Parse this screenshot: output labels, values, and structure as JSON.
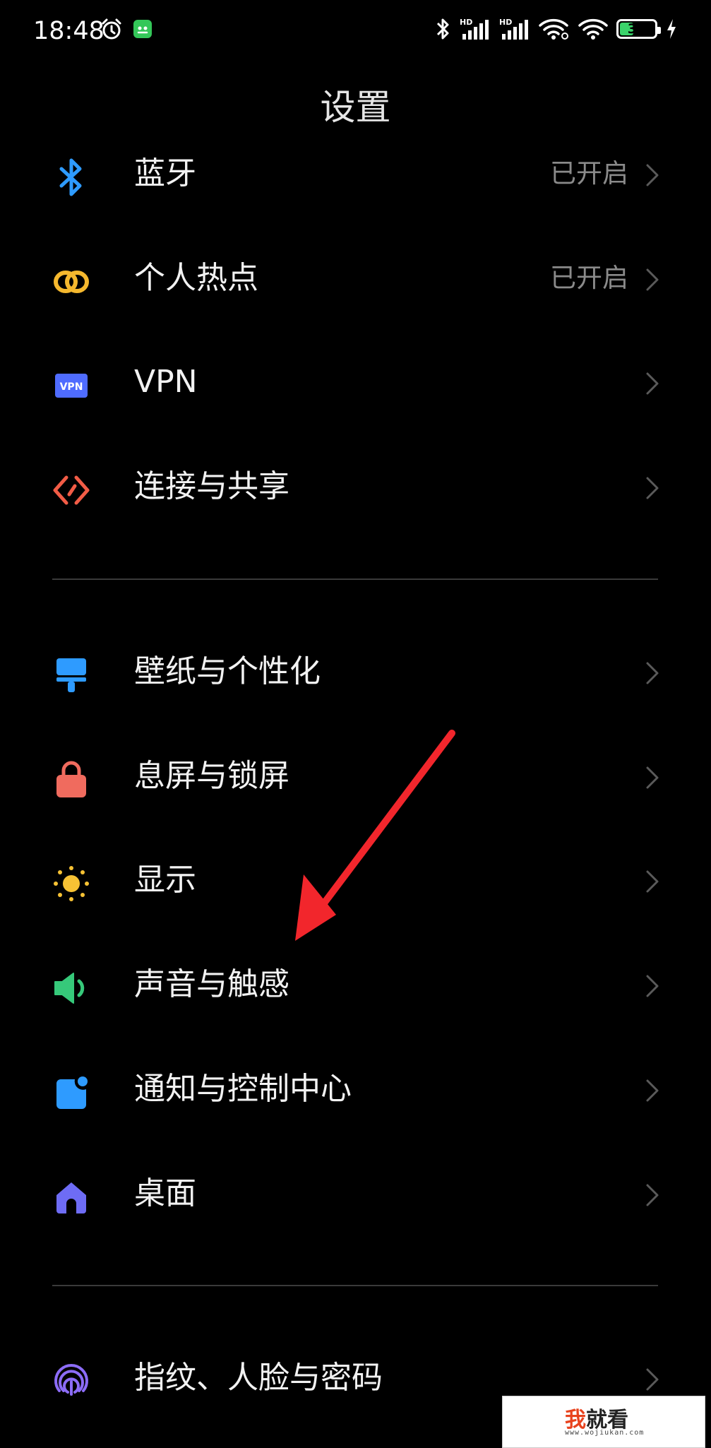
{
  "status_bar": {
    "time": "18:48",
    "battery_level": "36",
    "signal_label": "HD"
  },
  "page_title": "设置",
  "group1": [
    {
      "label": "蓝牙",
      "status": "已开启",
      "icon": "bluetooth-icon",
      "color": "#2e9bff"
    },
    {
      "label": "个人热点",
      "status": "已开启",
      "icon": "hotspot-icon",
      "color": "#f5b82e"
    },
    {
      "label": "VPN",
      "status": "",
      "icon": "vpn-icon",
      "color": "#4f6cff",
      "icon_text": "VPN"
    },
    {
      "label": "连接与共享",
      "status": "",
      "icon": "connection-share-icon",
      "color": "#f25c46"
    }
  ],
  "group2": [
    {
      "label": "壁纸与个性化",
      "icon": "wallpaper-icon",
      "color": "#2e9bff"
    },
    {
      "label": "息屏与锁屏",
      "icon": "lock-icon",
      "color": "#f06b5e"
    },
    {
      "label": "显示",
      "icon": "display-sun-icon",
      "color": "#f7c234"
    },
    {
      "label": "声音与触感",
      "icon": "sound-icon",
      "color": "#36c97a"
    },
    {
      "label": "通知与控制中心",
      "icon": "notification-icon",
      "color": "#2e9bff"
    },
    {
      "label": "桌面",
      "icon": "home-icon",
      "color": "#6e6cf5"
    }
  ],
  "group3": [
    {
      "label": "指纹、人脸与密码",
      "icon": "fingerprint-icon",
      "color": "#8c6cf7"
    }
  ],
  "watermark": {
    "brand_accent": "我",
    "brand_rest": "就看",
    "url": "www.wojiukan.com"
  }
}
